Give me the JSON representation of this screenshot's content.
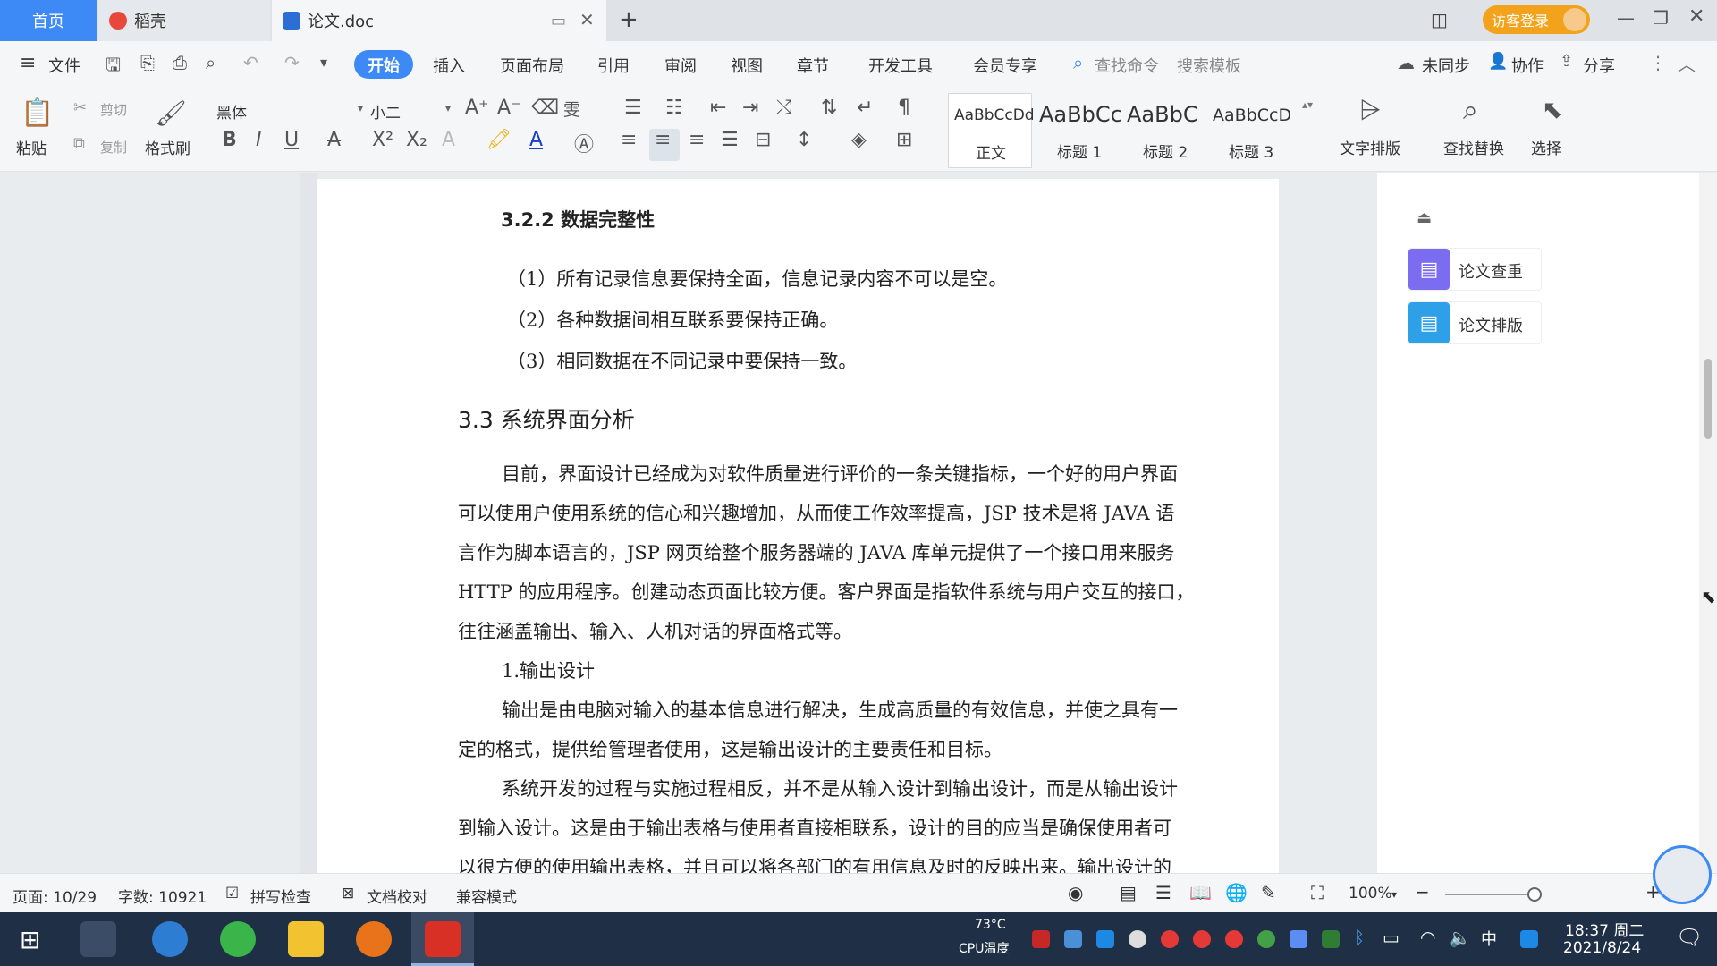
{
  "tabs": {
    "home": "首页",
    "daoke": "稻壳",
    "doc": "论文.doc",
    "login": "访客登录"
  },
  "menu": {
    "file": "文件",
    "items": [
      "开始",
      "插入",
      "页面布局",
      "引用",
      "审阅",
      "视图",
      "章节",
      "开发工具",
      "会员专享"
    ],
    "search_cmd": "查找命令",
    "search_tpl": "搜索模板",
    "sync": "未同步",
    "collab": "协作",
    "share": "分享"
  },
  "ribbon": {
    "paste": "粘贴",
    "cut": "剪切",
    "copy": "复制",
    "format_painter": "格式刷",
    "font": "黑体",
    "size": "小二",
    "styles": [
      {
        "preview": "AaBbCcDd",
        "name": "正文"
      },
      {
        "preview": "AaBbCc",
        "name": "标题 1"
      },
      {
        "preview": "AaBbC",
        "name": "标题 2"
      },
      {
        "preview": "AaBbCcD",
        "name": "标题 3"
      }
    ],
    "text_layout": "文字排版",
    "find_replace": "查找替换",
    "select": "选择"
  },
  "doc": {
    "h322": "3.2.2  数据完整性",
    "l1": "（1）所有记录信息要保持全面，信息记录内容不可以是空。",
    "l2": "（2）各种数据间相互联系要保持正确。",
    "l3": "（3）相同数据在不同记录中要保持一致。",
    "h33": "3.3 系统界面分析",
    "p1a": "目前，界面设计已经成为对软件质量进行评价的一条关键指标，一个好的用户界面",
    "p1b": "可以使用户使用系统的信心和兴趣增加，从而使工作效率提高，JSP 技术是将 JAVA 语",
    "p1c": "言作为脚本语言的，JSP 网页给整个服务器端的 JAVA 库单元提供了一个接口用来服务",
    "p1d": "HTTP 的应用程序。创建动态页面比较方便。客户界面是指软件系统与用户交互的接口，",
    "p1e": "往往涵盖输出、输入、人机对话的界面格式等。",
    "h_out": "1.输出设计",
    "p2a": "输出是由电脑对输入的基本信息进行解决，生成高质量的有效信息，并使之具有一",
    "p2b": "定的格式，提供给管理者使用，这是输出设计的主要责任和目标。",
    "p3a": "系统开发的过程与实施过程相反，并不是从输入设计到输出设计，而是从输出设计",
    "p3b": "到输入设计。这是由于输出表格与使用者直接相联系，设计的目的应当是确保使用者可",
    "p3c": "以很方便的使用输出表格，并且可以将各部门的有用信息及时的反映出来。输出设计的"
  },
  "panel": {
    "check": "论文查重",
    "layout": "论文排版"
  },
  "status": {
    "page": "页面: 10/29",
    "words": "字数: 10921",
    "spell": "拼写检查",
    "proof": "文档校对",
    "compat": "兼容模式",
    "zoom": "100%"
  },
  "taskbar": {
    "temp": "73°C",
    "cpu": "CPU温度",
    "ime": "中",
    "time": "18:37 周二",
    "date": "2021/8/24"
  },
  "colors": {
    "accent": "#3d8af7",
    "taskbar": "#1f2f45"
  }
}
